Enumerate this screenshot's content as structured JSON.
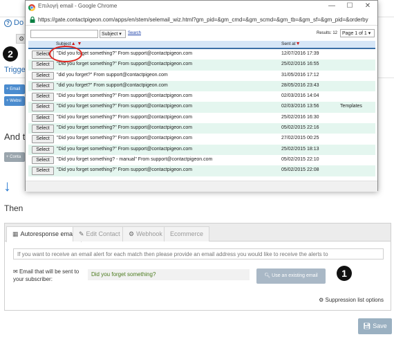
{
  "background": {
    "title_prefix": "Do s",
    "trigger_text": "Trigge",
    "buttons": [
      "+ Email",
      "+ Websi"
    ],
    "and_text": "And th",
    "contact_btn": "+ Conta",
    "then_text": "Then",
    "gear": "⚙"
  },
  "callouts": {
    "one": "1",
    "two": "2"
  },
  "popup": {
    "window_title": "Επιλογή email - Google Chrome",
    "window_controls": [
      "—",
      "☐",
      "✕"
    ],
    "url": "https://gate.contactpigeon.com/apps/en/stem/selemail_wiz.html?gm_pid=&gm_cmd=&gm_scmd=&gm_tb=&gm_sf=&gm_pid=&orderby",
    "filter_field": "Subject ▾",
    "search_link": "Search",
    "results": "Results: 12",
    "page_select": "Page 1 of 1 ▾",
    "headers": {
      "subject": "Subject",
      "sent": "Sent at"
    },
    "select_label": "Select",
    "rows": [
      {
        "subject": "\"Did you forget something?\"  From support@contactpigeon.com",
        "date": "12/07/2016 17:39",
        "tag": ""
      },
      {
        "subject": "\"Did you forget something?\"  From support@contactpigeon.com",
        "date": "25/02/2016 16:55",
        "tag": ""
      },
      {
        "subject": "\"did you forget?\"  From support@contactpigeon.com",
        "date": "31/05/2016 17:12",
        "tag": ""
      },
      {
        "subject": "\"did you forget?\"  From support@contactpigeon.com",
        "date": "28/05/2016 23:43",
        "tag": ""
      },
      {
        "subject": "\"Did you forget something?\"  From support@contactpigeon.com",
        "date": "02/03/2016 14:04",
        "tag": ""
      },
      {
        "subject": "\"Did you forget something?\"  From support@contactpigeon.com",
        "date": "02/03/2016 13:56",
        "tag": "Templates"
      },
      {
        "subject": "\"Did you forget something?\"  From support@contactpigeon.com",
        "date": "25/02/2016 16:30",
        "tag": ""
      },
      {
        "subject": "\"Did you forget something?\"  From support@contactpigeon.com",
        "date": "05/02/2015 22:16",
        "tag": ""
      },
      {
        "subject": "\"Did you forget something?\"  From support@contactpigeon.com",
        "date": "27/02/2015 00:25",
        "tag": ""
      },
      {
        "subject": "\"Did you forget something?\"  From support@contactpigeon.com",
        "date": "25/02/2015 18:13",
        "tag": ""
      },
      {
        "subject": "\"Did you forget something? - manual\"  From support@contactpigeon.com",
        "date": "05/02/2015 22:10",
        "tag": ""
      },
      {
        "subject": "\"Did you forget something?\"  From support@contactpigeon.com",
        "date": "05/02/2015 22:08",
        "tag": ""
      }
    ]
  },
  "panel": {
    "tabs": [
      "Autoresponse email",
      "Edit Contact",
      "Webhook",
      "Ecommerce"
    ],
    "tab_icons": [
      "▦",
      "✎",
      "⚙",
      ""
    ],
    "email_placeholder": "If you want to receive an email alert for each match then please provide an email address you would like to receive the alerts to",
    "sent_label": "Email that will be sent to your subscriber:",
    "envelope_icon": "✉",
    "subject_value": "Did you forget something?",
    "use_existing": "Use an existing email",
    "suppression": "Suppression list options",
    "save": "Save"
  },
  "colors": {
    "accent": "#2a6db3",
    "row_alt": "#e4f6ef",
    "highlight": "#e0261f",
    "table_header": "#d6e6f7"
  }
}
